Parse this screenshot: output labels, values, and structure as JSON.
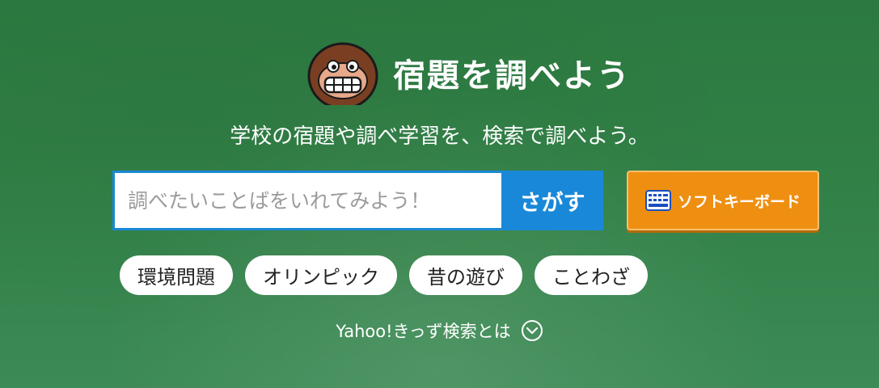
{
  "header": {
    "title": "宿題を調べよう",
    "mascot_icon": "monkey-mascot-icon"
  },
  "subtitle": "学校の宿題や調べ学習を、検索で調べよう。",
  "search": {
    "placeholder": "調べたいことばをいれてみよう！",
    "value": "",
    "button_label": "さがす"
  },
  "keyboard": {
    "label": "ソフトキーボード",
    "icon": "keyboard-icon"
  },
  "suggestions": [
    "環境問題",
    "オリンピック",
    "昔の遊び",
    "ことわざ"
  ],
  "about": {
    "label": "Yahoo!きっず検索とは",
    "icon": "chevron-down-circle-icon"
  },
  "colors": {
    "background": "#307f45",
    "search_accent": "#1a88d8",
    "keyboard_button": "#ee8f12",
    "chip_background": "#ffffff"
  }
}
